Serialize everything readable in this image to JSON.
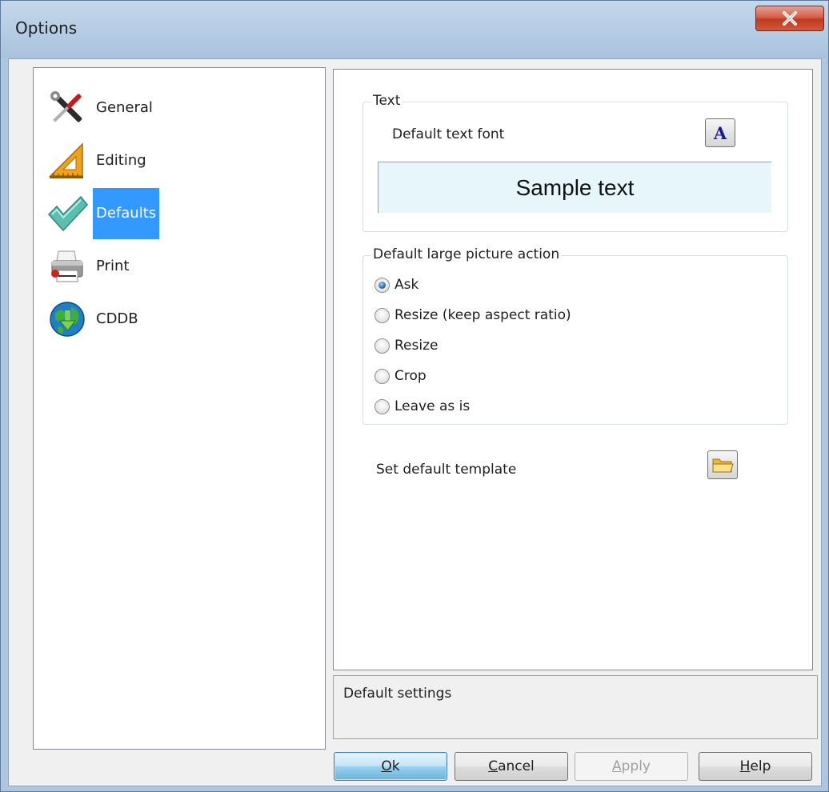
{
  "window": {
    "title": "Options",
    "close_glyph": "X"
  },
  "categories": [
    {
      "label": "General",
      "icon": "tools-icon",
      "selected": false
    },
    {
      "label": "Editing",
      "icon": "ruler-triangle-icon",
      "selected": false
    },
    {
      "label": "Defaults",
      "icon": "checkmark-icon",
      "selected": true
    },
    {
      "label": "Print",
      "icon": "printer-icon",
      "selected": false
    },
    {
      "label": "CDDB",
      "icon": "globe-download-icon",
      "selected": false
    }
  ],
  "text_group": {
    "legend": "Text",
    "default_font_label": "Default text font",
    "font_button_glyph": "A",
    "sample_text": "Sample text"
  },
  "picture_group": {
    "legend": "Default large picture action",
    "options": [
      {
        "label": "Ask",
        "checked": true
      },
      {
        "label": "Resize (keep aspect ratio)",
        "checked": false
      },
      {
        "label": "Resize",
        "checked": false
      },
      {
        "label": "Crop",
        "checked": false
      },
      {
        "label": "Leave as is",
        "checked": false
      }
    ]
  },
  "template": {
    "label": "Set default template"
  },
  "description": "Default settings",
  "buttons": {
    "ok": {
      "label": "Ok",
      "underline_index": 0
    },
    "cancel": {
      "label": "Cancel",
      "underline_index": 0
    },
    "apply": {
      "label": "Apply",
      "underline_index": 0,
      "disabled": true
    },
    "help": {
      "label": "Help",
      "underline_index": 0
    }
  },
  "colors": {
    "selection": "#3399ff",
    "sample_bg": "#e7f6fb",
    "close_red": "#c1391e"
  }
}
